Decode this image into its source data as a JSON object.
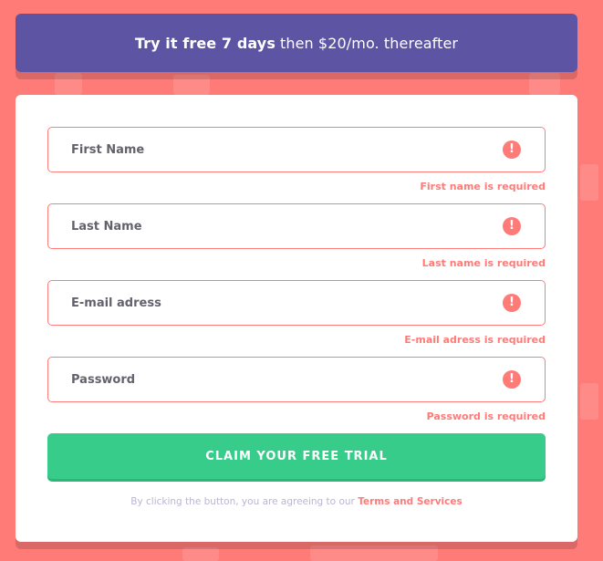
{
  "banner": {
    "strong": "Try it free 7 days",
    "rest": "then $20/mo. thereafter"
  },
  "form": {
    "fields": [
      {
        "placeholder": "First Name",
        "error": "First name is required",
        "icon": "!"
      },
      {
        "placeholder": "Last Name",
        "error": "Last name is required",
        "icon": "!"
      },
      {
        "placeholder": "E-mail adress",
        "error": "E-mail adress is required",
        "icon": "!"
      },
      {
        "placeholder": "Password",
        "error": "Password is required",
        "icon": "!"
      }
    ],
    "submit_label": "CLAIM YOUR FREE TRIAL",
    "terms_prefix": "By clicking the button, you are agreeing to our",
    "terms_link": "Terms and Services"
  },
  "colors": {
    "background": "#ff7b78",
    "banner": "#5e54a4",
    "accent_green": "#38cc8b",
    "error_red": "#ff7b78"
  }
}
